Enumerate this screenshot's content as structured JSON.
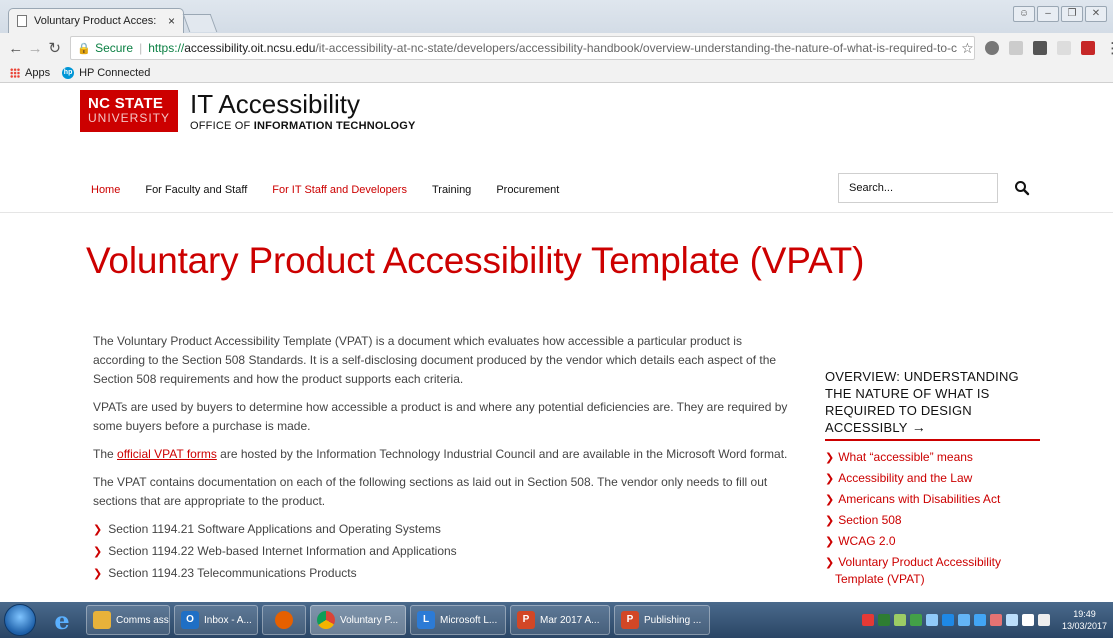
{
  "browser": {
    "tab_title": "Voluntary Product Acces:",
    "tab_close": "×",
    "secure_label": "Secure",
    "url_scheme": "https://",
    "url_host": "accessibility.oit.ncsu.edu",
    "url_path": "/it-accessibility-at-nc-state/developers/accessibility-handbook/overview-understanding-the-nature-of-what-is-required-to-c",
    "bookmarks": [
      {
        "label": "Apps",
        "icon": "apps-grid-icon"
      },
      {
        "label": "HP Connected",
        "icon": "hp-icon"
      }
    ]
  },
  "site": {
    "logo_line1": "NC STATE",
    "logo_line2": "UNIVERSITY",
    "title": "IT Accessibility",
    "subtitle_prefix": "OFFICE OF ",
    "subtitle_bold": "INFORMATION TECHNOLOGY",
    "nav": [
      "Home",
      "For Faculty and Staff",
      "For IT Staff and Developers",
      "Training",
      "Procurement"
    ],
    "search_placeholder": "Search...",
    "accent": "#cc0000"
  },
  "article": {
    "heading": "Voluntary Product Accessibility Template (VPAT)",
    "p1": "The Voluntary Product Accessibility Template (VPAT) is a document which evaluates how accessible a particular product is according to the Section 508 Standards. It is a self-disclosing document produced by the vendor which details each aspect of the Section 508 requirements and how the product supports each criteria.",
    "p2": "VPATs are used by buyers to determine how accessible a product is and where any potential deficiencies are. They are required by some buyers before a purchase is made.",
    "p3_before": "The ",
    "p3_link": "official VPAT forms",
    "p3_after": " are hosted by the Information Technology Industrial Council and are available in the Microsoft Word format.",
    "p4": "The VPAT contains documentation on each of the following sections as laid out in Section 508. The vendor only needs to fill out sections that are appropriate to the product.",
    "list": [
      "Section 1194.21 Software Applications and Operating Systems",
      "Section 1194.22 Web-based Internet Information and Applications",
      "Section 1194.23 Telecommunications Products"
    ]
  },
  "sidebar": {
    "heading": "OVERVIEW: UNDERSTANDING THE NATURE OF WHAT IS REQUIRED TO DESIGN ACCESSIBLY",
    "arrow": "→",
    "items": [
      "What “accessible” means",
      "Accessibility and the Law",
      "Americans with Disabilities Act",
      "Section 508",
      "WCAG 2.0",
      "Voluntary Product Accessibility Template (VPAT)"
    ]
  },
  "taskbar": {
    "tasks": [
      {
        "label": "Comms ass...",
        "icon": "folder-icon",
        "color": "#e8b23a"
      },
      {
        "label": "Inbox - A...",
        "icon": "outlook-icon",
        "color": "#1f6fc5"
      },
      {
        "label": "",
        "icon": "firefox-icon",
        "color": "#e66000"
      },
      {
        "label": "Voluntary P...",
        "icon": "chrome-icon",
        "color": "#db4437"
      },
      {
        "label": "Microsoft L...",
        "icon": "lync-icon",
        "color": "#2c7bd6"
      },
      {
        "label": "Mar 2017 A...",
        "icon": "powerpoint-icon",
        "color": "#d24726"
      },
      {
        "label": "Publishing ...",
        "icon": "powerpoint-icon",
        "color": "#d24726"
      }
    ],
    "time": "19:49",
    "date": "13/03/2017"
  }
}
